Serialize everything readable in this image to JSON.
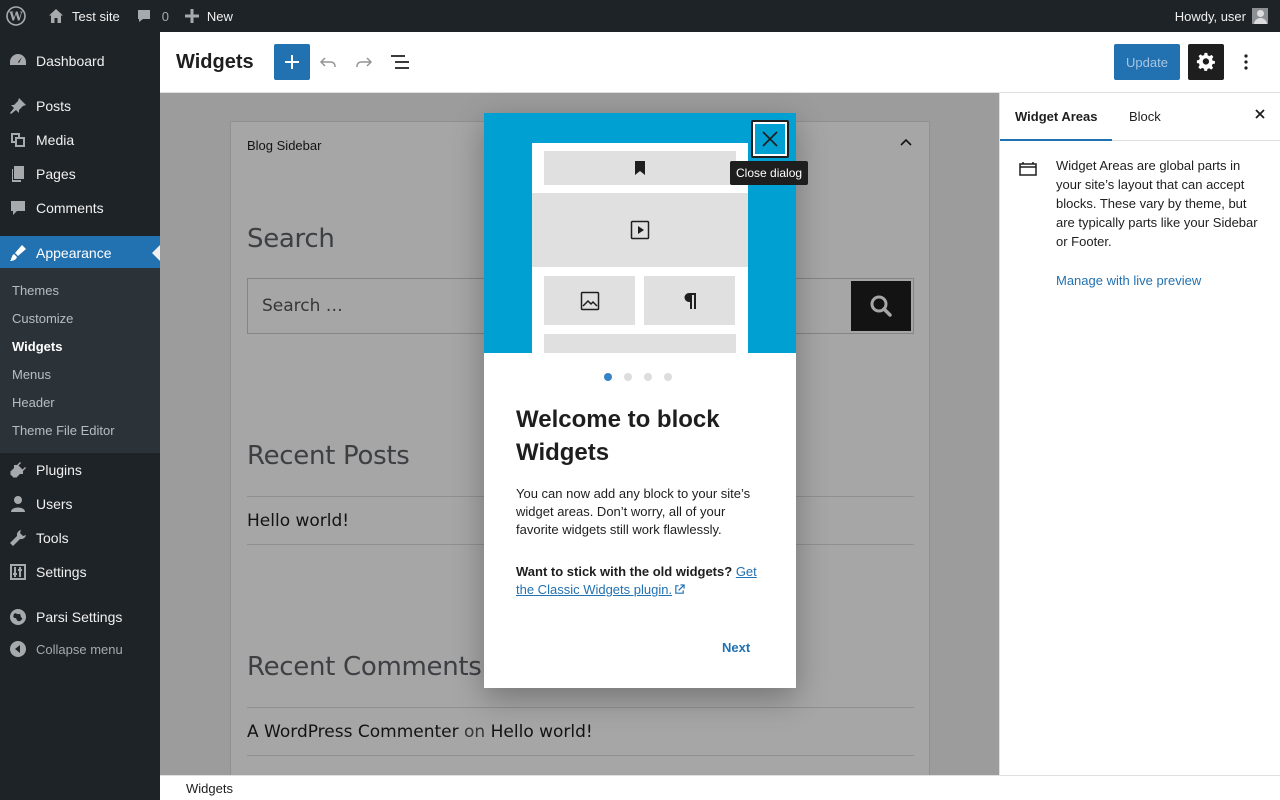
{
  "adminbar": {
    "site_name": "Test site",
    "comments_count": "0",
    "new_label": "New",
    "howdy": "Howdy, user"
  },
  "menu": {
    "dashboard": "Dashboard",
    "posts": "Posts",
    "media": "Media",
    "pages": "Pages",
    "comments": "Comments",
    "appearance": "Appearance",
    "submenu": [
      "Themes",
      "Customize",
      "Widgets",
      "Menus",
      "Header",
      "Theme File Editor"
    ],
    "plugins": "Plugins",
    "users": "Users",
    "tools": "Tools",
    "settings": "Settings",
    "parsi": "Parsi Settings",
    "collapse": "Collapse menu"
  },
  "header": {
    "title": "Widgets",
    "update_label": "Update"
  },
  "canvas": {
    "area_title": "Blog Sidebar",
    "search_heading": "Search",
    "search_placeholder": "Search …",
    "recent_posts_heading": "Recent Posts",
    "recent_post_1": "Hello world!",
    "recent_comments_heading": "Recent Comments",
    "comment_author": "A WordPress Commenter",
    "comment_on": "on",
    "comment_post": "Hello world!"
  },
  "inspector": {
    "tab_areas": "Widget Areas",
    "tab_block": "Block",
    "description": "Widget Areas are global parts in your site’s layout that can accept blocks. These vary by theme, but are typically parts like your Sidebar or Footer.",
    "link": "Manage with live preview"
  },
  "footer": {
    "breadcrumb": "Widgets"
  },
  "dialog": {
    "tooltip": "Close dialog",
    "heading": "Welcome to block Widgets",
    "text": "You can now add any block to your site’s widget areas. Don’t worry, all of your favorite widgets still work flawlessly.",
    "text2_bold": "Want to stick with the old widgets?",
    "text2_link": "Get the Classic Widgets plugin.",
    "next_label": "Next",
    "dots_total": 4,
    "dot_active": 1
  },
  "colors": {
    "accent": "#2271b1",
    "admin_dark": "#1d2327",
    "hero": "#00a0d2"
  }
}
